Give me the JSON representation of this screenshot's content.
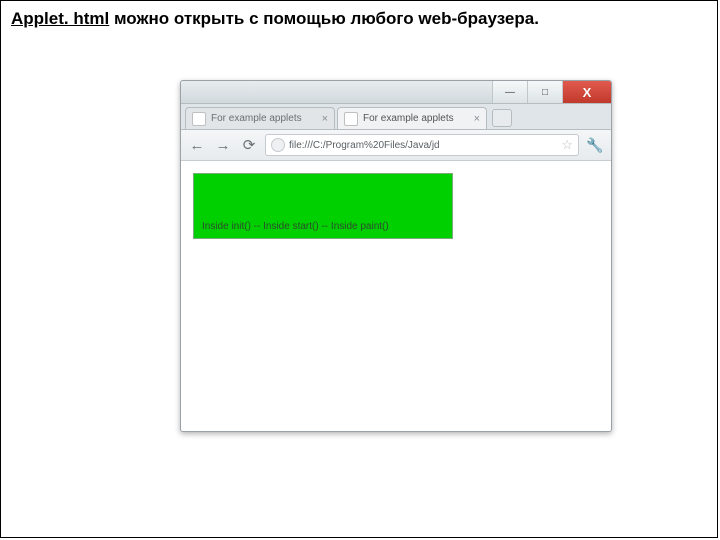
{
  "caption": {
    "part1": "Applet. html",
    "part2": " можно открыть с помощью любого web-браузера."
  },
  "windowButtons": {
    "minimize": "—",
    "maximize": "□",
    "close": "X"
  },
  "tabs": [
    {
      "label": "For example applets",
      "close": "×",
      "active": false
    },
    {
      "label": "For example applets",
      "close": "×",
      "active": true
    }
  ],
  "toolbar": {
    "back": "←",
    "forward": "→",
    "reload": "⟳",
    "address": "file:///C:/Program%20Files/Java/jd",
    "star": "☆",
    "menu": "🔧"
  },
  "applet": {
    "text": "Inside init() -- Inside start() -- Inside paint()",
    "bg": "#00d000"
  }
}
